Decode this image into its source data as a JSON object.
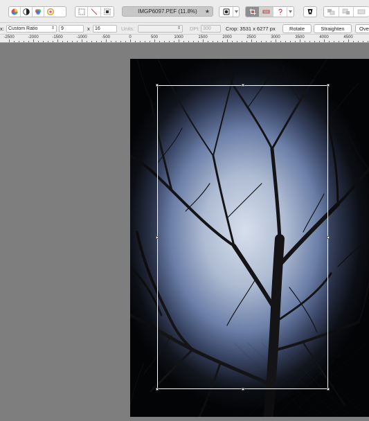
{
  "toolbar": {
    "document_title": "IMGP6097.PEF (11.8%)",
    "favorite_glyph": "★"
  },
  "crop_options": {
    "cut_label": "x:",
    "ratio_select": "Custom Ratio",
    "ratio_width": "9",
    "times_label": "x",
    "ratio_height": "16",
    "units_label": "Units:",
    "units_value": "",
    "dpi_label": "DPI:",
    "dpi_value": "300",
    "crop_size_text": "Crop: 3531 x 6277 px",
    "rotate_label": "Rotate",
    "straighten_label": "Straighten",
    "overflow_label": "Ove"
  },
  "ruler": {
    "labels": [
      "-2500",
      "-2000",
      "-1500",
      "-1000",
      "-500",
      "0",
      "500",
      "1000",
      "1500",
      "2000",
      "2500",
      "3000",
      "3500",
      "4000",
      "4500"
    ]
  },
  "icons": [
    "color-wheel-icon",
    "contrast-icon",
    "rgb-icon",
    "hsl-icon",
    "marquee-select-icon",
    "line-icon",
    "move-select-icon",
    "mask-icon",
    "crop-icon",
    "straighten-icon",
    "help-icon",
    "erase-icon",
    "layers-icon"
  ],
  "colors": {
    "toolbar_bg": "#ececec",
    "canvas_bg": "#7e7e7e",
    "active_tool_bg": "#8e8e8e",
    "crop_border": "#ffffff"
  }
}
